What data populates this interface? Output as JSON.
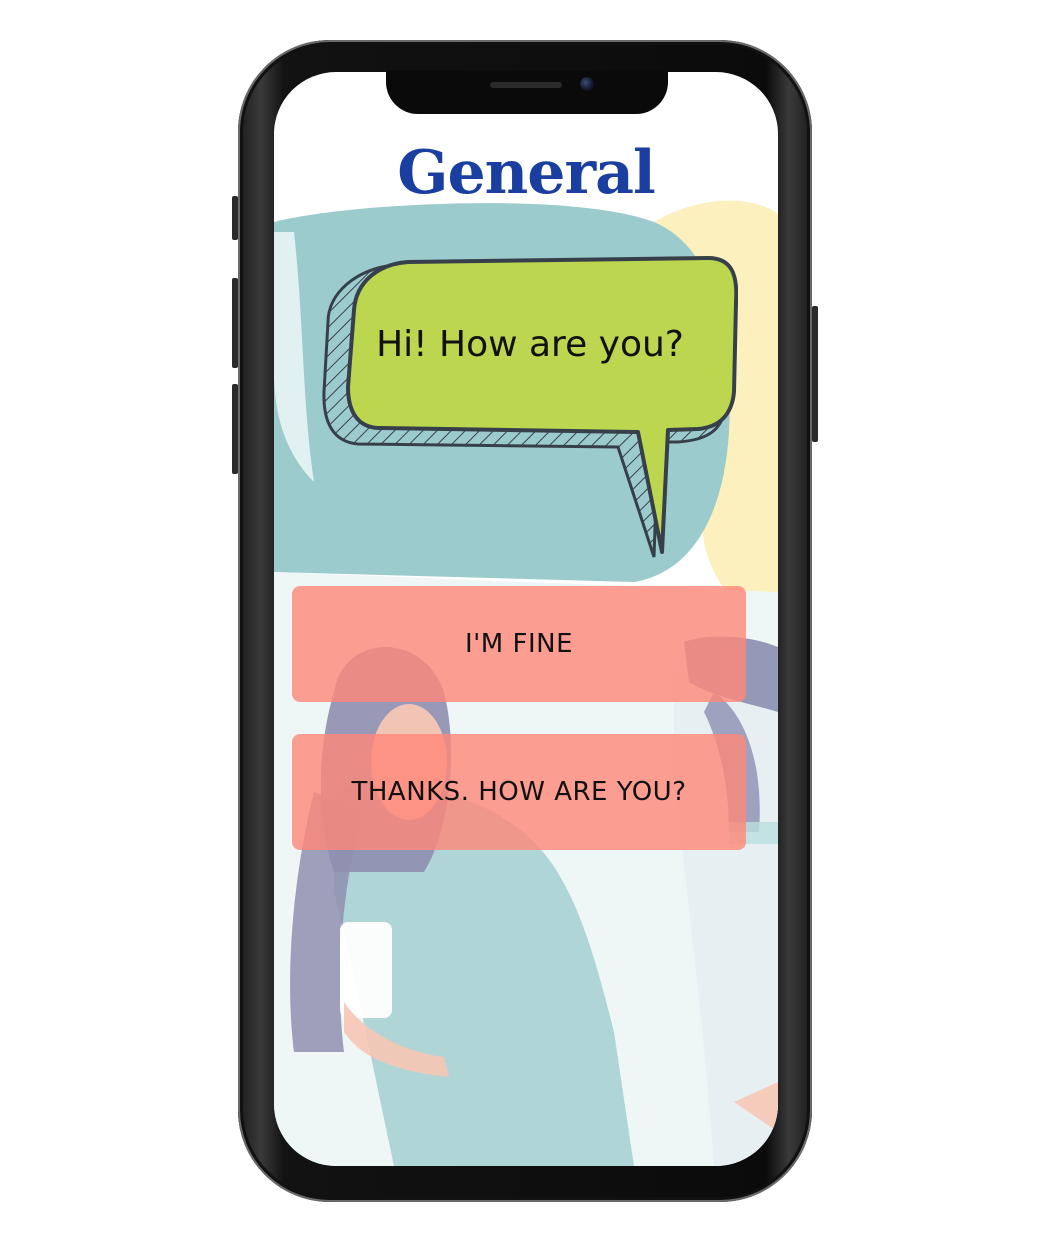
{
  "screen": {
    "title": "General",
    "prompt_bubble": {
      "text": "Hi! How are you?"
    },
    "answers": [
      {
        "label": "I'M FINE"
      },
      {
        "label": "THANKS. HOW ARE YOU?"
      }
    ]
  },
  "colors": {
    "title": "#1a3fa0",
    "bubble_fill": "#bcd64f",
    "bubble_outline": "#37404a",
    "answer_button": "#ff8778",
    "bg_teal": "#9bcbcd",
    "bg_yellow": "#fdeeb8"
  }
}
